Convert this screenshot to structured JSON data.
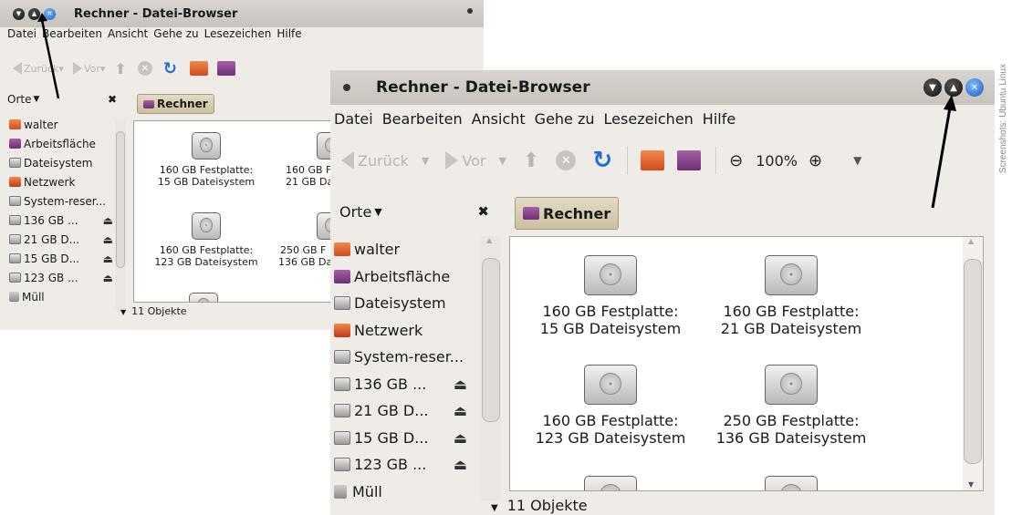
{
  "window": {
    "title": "Rechner - Datei-Browser",
    "menu": [
      "Datei",
      "Bearbeiten",
      "Ansicht",
      "Gehe zu",
      "Lesezeichen",
      "Hilfe"
    ],
    "toolbar": {
      "back": "Zurück",
      "forward": "Vor",
      "zoom": "100%"
    },
    "sidebar_title": "Orte",
    "path_button": "Rechner",
    "places": [
      {
        "label": "walter",
        "icon": "home-folder-icon"
      },
      {
        "label": "Arbeitsfläche",
        "icon": "desktop-icon"
      },
      {
        "label": "Dateisystem",
        "icon": "drive-icon"
      },
      {
        "label": "Netzwerk",
        "icon": "network-icon"
      },
      {
        "label": "System-reser...",
        "icon": "drive-icon"
      },
      {
        "label": "136 GB ...",
        "icon": "drive-icon",
        "eject": true
      },
      {
        "label": "21 GB D...",
        "icon": "drive-icon",
        "eject": true
      },
      {
        "label": "15 GB D...",
        "icon": "drive-icon",
        "eject": true
      },
      {
        "label": "123 GB ...",
        "icon": "drive-icon",
        "eject": true
      },
      {
        "label": "Müll",
        "icon": "trash-icon"
      }
    ],
    "files": [
      {
        "line1": "160 GB Festplatte:",
        "line2": "15 GB Dateisystem"
      },
      {
        "line1": "160 GB Festplatte:",
        "line2": "21 GB Dateisystem"
      },
      {
        "line1": "160 GB Festplatte:",
        "line2": "123 GB Dateisystem"
      },
      {
        "line1": "250 GB Festplatte:",
        "line2": "136 GB Dateisystem"
      }
    ],
    "status": "11 Objekte"
  },
  "small_window": {
    "menu": [
      "Datei",
      "Bearbeiten",
      "Ansicht",
      "Gehe zu",
      "Lesezeichen",
      "Hilfe"
    ],
    "files_right_cut": [
      {
        "line1": "160 GB F",
        "line2": "21 GB Da"
      },
      {
        "line1": "250 GB F",
        "line2": "136 GB Da"
      }
    ]
  },
  "caption": "Screenshots: Ubuntu Linux",
  "colors": {
    "titlebar": "#c9c3bd",
    "window_bg": "#efebe7",
    "accent_blue": "#1f5fbf"
  }
}
